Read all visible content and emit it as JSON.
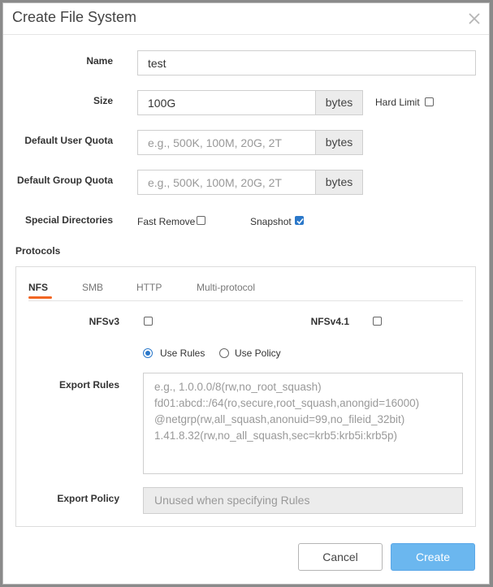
{
  "dialog": {
    "title": "Create File System",
    "close_icon": "close-x-icon"
  },
  "form": {
    "name": {
      "label": "Name",
      "value": "test"
    },
    "size": {
      "label": "Size",
      "value": "100G",
      "unit": "bytes"
    },
    "hard_limit": {
      "label": "Hard Limit",
      "checked": false
    },
    "default_user_quota": {
      "label": "Default User Quota",
      "placeholder": "e.g., 500K, 100M, 20G, 2T",
      "unit": "bytes"
    },
    "default_group_quota": {
      "label": "Default Group Quota",
      "placeholder": "e.g., 500K, 100M, 20G, 2T",
      "unit": "bytes"
    },
    "special_directories": {
      "label": "Special Directories",
      "fast_remove": {
        "label": "Fast Remove",
        "checked": false
      },
      "snapshot": {
        "label": "Snapshot",
        "checked": true
      }
    }
  },
  "protocols": {
    "label": "Protocols",
    "tabs": [
      {
        "label": "NFS",
        "active": true
      },
      {
        "label": "SMB",
        "active": false
      },
      {
        "label": "HTTP",
        "active": false
      },
      {
        "label": "Multi-protocol",
        "active": false
      }
    ],
    "nfsv3": {
      "label": "NFSv3",
      "checked": false
    },
    "nfsv41": {
      "label": "NFSv4.1",
      "checked": false
    },
    "use_rules": {
      "label": "Use Rules",
      "selected": true
    },
    "use_policy": {
      "label": "Use Policy",
      "selected": false
    },
    "export_rules": {
      "label": "Export Rules",
      "placeholder": "e.g., 1.0.0.0/8(rw,no_root_squash)\nfd01:abcd::/64(ro,secure,root_squash,anongid=16000)\n@netgrp(rw,all_squash,anonuid=99,no_fileid_32bit)\n1.41.8.32(rw,no_all_squash,sec=krb5:krb5i:krb5p)"
    },
    "export_policy": {
      "label": "Export Policy",
      "placeholder": "Unused when specifying Rules"
    }
  },
  "buttons": {
    "cancel": "Cancel",
    "create": "Create"
  },
  "colors": {
    "accent": "#2b78c9",
    "tab_underline": "#f26522",
    "create_button": "#6bb7ef"
  }
}
